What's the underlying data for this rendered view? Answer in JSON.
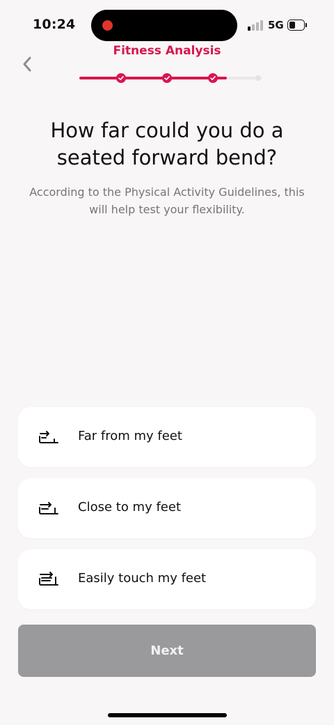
{
  "status_bar": {
    "time": "10:24",
    "network": "5G",
    "icons": [
      "recording-dot-icon",
      "signal-bars-icon",
      "battery-icon"
    ]
  },
  "header": {
    "title": "Fitness Analysis",
    "back_icon": "chevron-left-icon",
    "progress": {
      "completed_steps": 3,
      "total_steps": 4,
      "fill_fraction": 0.81
    }
  },
  "question": {
    "title": "How far could you do a seated forward bend?",
    "subtitle": "According to the Physical Activity Guidelines, this will help test your flexibility."
  },
  "options": [
    {
      "label": "Far from my feet",
      "icon": "seated-bend-far-icon"
    },
    {
      "label": "Close to my feet",
      "icon": "seated-bend-close-icon"
    },
    {
      "label": "Easily touch my feet",
      "icon": "seated-bend-touch-icon"
    }
  ],
  "next_button": {
    "label": "Next",
    "enabled": false
  },
  "colors": {
    "accent": "#d7174f",
    "background": "#f9f6f8",
    "card": "#ffffff",
    "button_disabled": "#9a999b",
    "subtitle": "#767676"
  }
}
